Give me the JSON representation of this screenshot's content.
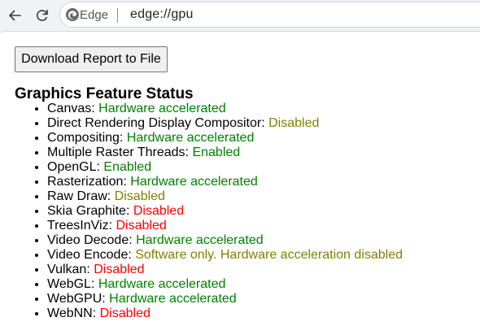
{
  "browser": {
    "brand_label": "Edge",
    "url": "edge://gpu"
  },
  "page": {
    "download_button_label": "Download Report to File",
    "section_title": "Graphics Feature Status",
    "features": [
      {
        "name": "Canvas: ",
        "status": "Hardware accelerated",
        "status_color": "green"
      },
      {
        "name": "Direct Rendering Display Compositor: ",
        "status": "Disabled",
        "status_color": "olive"
      },
      {
        "name": "Compositing: ",
        "status": "Hardware accelerated",
        "status_color": "green"
      },
      {
        "name": "Multiple Raster Threads: ",
        "status": "Enabled",
        "status_color": "green"
      },
      {
        "name": "OpenGL: ",
        "status": "Enabled",
        "status_color": "green"
      },
      {
        "name": "Rasterization: ",
        "status": "Hardware accelerated",
        "status_color": "green"
      },
      {
        "name": "Raw Draw: ",
        "status": "Disabled",
        "status_color": "olive"
      },
      {
        "name": "Skia Graphite: ",
        "status": "Disabled",
        "status_color": "red"
      },
      {
        "name": "TreesInViz: ",
        "status": "Disabled",
        "status_color": "red"
      },
      {
        "name": "Video Decode: ",
        "status": "Hardware accelerated",
        "status_color": "green"
      },
      {
        "name": "Video Encode: ",
        "status": "Software only. Hardware acceleration disabled",
        "status_color": "olive"
      },
      {
        "name": "Vulkan: ",
        "status": "Disabled",
        "status_color": "red"
      },
      {
        "name": "WebGL: ",
        "status": "Hardware accelerated",
        "status_color": "green"
      },
      {
        "name": "WebGPU: ",
        "status": "Hardware accelerated",
        "status_color": "green"
      },
      {
        "name": "WebNN: ",
        "status": "Disabled",
        "status_color": "red"
      }
    ]
  },
  "colors": {
    "green": "#008000",
    "olive": "#808000",
    "red": "#ff0000"
  }
}
